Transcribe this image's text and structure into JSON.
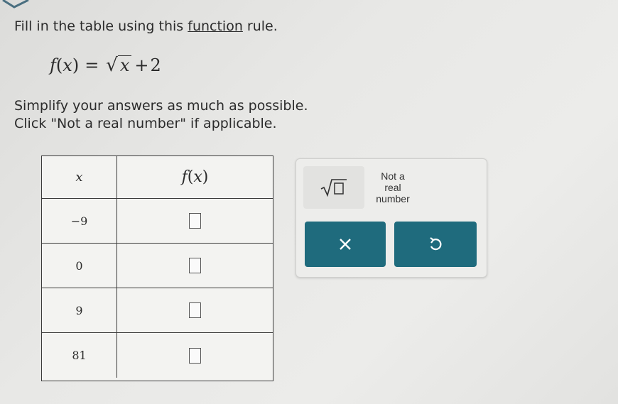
{
  "instructions": {
    "line1_prefix": "Fill in the table using this ",
    "line1_link": "function",
    "line1_suffix": " rule.",
    "line3": "Simplify your answers as much as possible.",
    "line4": "Click \"Not a real number\" if applicable."
  },
  "formula": {
    "f": "f",
    "x": "x",
    "lparen": "(",
    "rparen": ")",
    "equals": "=",
    "radicand": "x",
    "plus": "+",
    "constant": "2"
  },
  "table": {
    "header_x": "x",
    "header_fx": {
      "f": "f",
      "lp": "(",
      "x": "x",
      "rp": ")"
    },
    "rows": [
      {
        "x": "−9",
        "fx": ""
      },
      {
        "x": "0",
        "fx": ""
      },
      {
        "x": "9",
        "fx": ""
      },
      {
        "x": "81",
        "fx": ""
      }
    ]
  },
  "keypad": {
    "not_real_line1": "Not a",
    "not_real_line2": "real",
    "not_real_line3": "number"
  },
  "colors": {
    "button": "#1f6b7d",
    "background": "#e8e8e6"
  },
  "icons": {
    "sqrt": "sqrt-template-icon",
    "clear": "x-icon",
    "undo": "undo-icon"
  }
}
